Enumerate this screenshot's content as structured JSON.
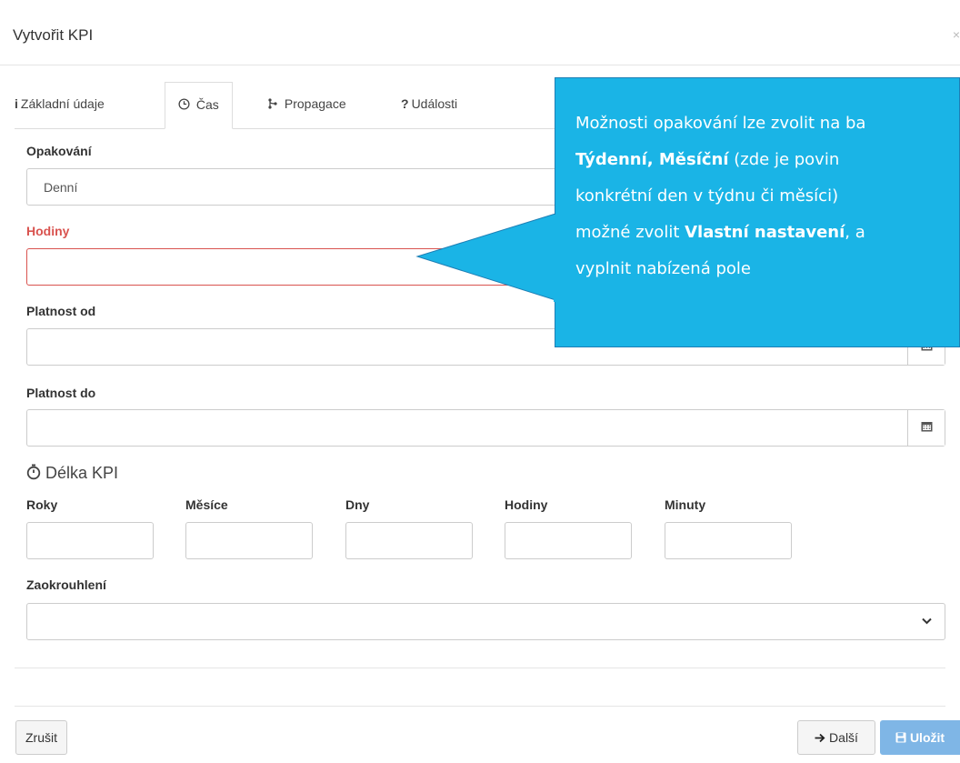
{
  "modal": {
    "title": "Vytvořit KPI",
    "close": "×"
  },
  "tabs": [
    {
      "icon": "info-icon",
      "glyph": "ℹ",
      "label": "Základní údaje"
    },
    {
      "icon": "clock-icon",
      "glyph": "🕓",
      "label": "Čas"
    },
    {
      "icon": "propagation-icon",
      "glyph": "ʂ",
      "label": "Propagace"
    },
    {
      "icon": "question-icon",
      "glyph": "?",
      "label": "Události"
    }
  ],
  "form": {
    "repeat_label": "Opakování",
    "repeat_value": "Denní",
    "hours_label": "Hodiny",
    "valid_from_label": "Platnost od",
    "valid_to_label": "Platnost do",
    "duration_title": "Délka KPI",
    "duration_fields": [
      "Roky",
      "Měsíce",
      "Dny",
      "Hodiny",
      "Minuty"
    ],
    "rounding_label": "Zaokrouhlení"
  },
  "footer": {
    "cancel": "Zrušit",
    "next": "Další",
    "save": "Uložit"
  },
  "callout": {
    "line1": "Možnosti opakování lze zvolit na ba",
    "line2_bold": "Týdenní, Měsíční",
    "line2_rest": " (zde je povin",
    "line3": "konkrétní den v týdnu či měsíci)",
    "line4_pre": "možné zvolit ",
    "line4_bold": "Vlastní nastavení",
    "line4_post": ", a",
    "line5": "vyplnit nabízená pole"
  },
  "colors": {
    "error": "#d9534f",
    "callout_bg": "#1ab4e6",
    "primary_btn": "#7fb6e6"
  }
}
